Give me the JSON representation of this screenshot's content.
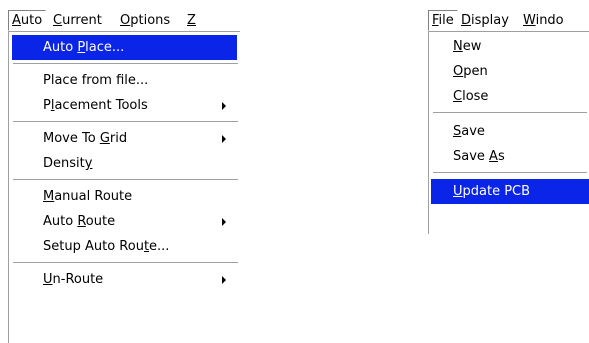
{
  "left_menu": {
    "menubar": [
      {
        "pre": "",
        "ul": "A",
        "post": "uto"
      },
      {
        "pre": "",
        "ul": "C",
        "post": "urrent"
      },
      {
        "pre": "",
        "ul": "O",
        "post": "ptions"
      },
      {
        "pre": "",
        "ul": "Z",
        "post": ""
      }
    ],
    "items": {
      "auto_place": {
        "pre": "Auto ",
        "ul": "P",
        "post": "lace..."
      },
      "place_from_file": {
        "pre": "Place from file...",
        "ul": "",
        "post": ""
      },
      "placement_tools": {
        "pre": "P",
        "ul": "l",
        "post": "acement Tools"
      },
      "move_to_grid": {
        "pre": "Move To ",
        "ul": "G",
        "post": "rid"
      },
      "density": {
        "pre": "Densit",
        "ul": "y",
        "post": ""
      },
      "manual_route": {
        "pre": "",
        "ul": "M",
        "post": "anual Route"
      },
      "auto_route": {
        "pre": "Auto ",
        "ul": "R",
        "post": "oute"
      },
      "setup_auto_route": {
        "pre": "Setup Auto Rou",
        "ul": "t",
        "post": "e..."
      },
      "un_route": {
        "pre": "",
        "ul": "U",
        "post": "n-Route"
      }
    }
  },
  "right_menu": {
    "menubar": [
      {
        "pre": "",
        "ul": "F",
        "post": "ile"
      },
      {
        "pre": "",
        "ul": "D",
        "post": "isplay"
      },
      {
        "pre": "",
        "ul": "W",
        "post": "indo"
      }
    ],
    "items": {
      "new": {
        "pre": "",
        "ul": "N",
        "post": "ew"
      },
      "open": {
        "pre": "",
        "ul": "O",
        "post": "pen"
      },
      "close": {
        "pre": "",
        "ul": "C",
        "post": "lose"
      },
      "save": {
        "pre": "",
        "ul": "S",
        "post": "ave"
      },
      "save_as": {
        "pre": "Save ",
        "ul": "A",
        "post": "s"
      },
      "update_pcb": {
        "pre": "",
        "ul": "U",
        "post": "pdate PCB"
      }
    }
  },
  "colors": {
    "highlight": "#0a24e8",
    "separator": "#a0a0a0"
  },
  "icons": {
    "submenu": "chevron-right-icon"
  }
}
